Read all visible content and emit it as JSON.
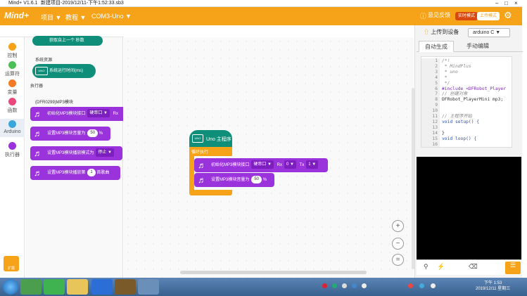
{
  "titlebar": {
    "app_version": "Mind+ V1.6.1",
    "file_title": "新建项目-2019/12/11-下午1:52:33.sb3",
    "minimize": "–",
    "maximize": "□",
    "close": "×"
  },
  "header": {
    "logo": "Mind+",
    "menu": {
      "project": "项目 ▼",
      "tutorial": "教程 ▼",
      "port": "COM3-Uno ▼"
    },
    "feedback": "意见反馈",
    "realtime_mode": "实时模式",
    "upload_mode": "上传模式",
    "settings_icon": "gear-icon"
  },
  "categories": {
    "module_tab": "模块",
    "items": [
      {
        "label": "控制",
        "color": "#f6a31a"
      },
      {
        "label": "运算符",
        "color": "#4cbf56"
      },
      {
        "label": "变量",
        "color": "#f47b25"
      },
      {
        "label": "函数",
        "color": "#e8487a"
      },
      {
        "label": "Arduino",
        "color": "#3aa6d9"
      },
      {
        "label": "执行器",
        "color": "#9b33dd"
      }
    ],
    "extension_label": "扩展"
  },
  "palette": {
    "partial_block": "获取自上一个  秒数",
    "system_resource_label": "系统资源",
    "system_runtime_block": "系统运行时间(ms)",
    "actuator_label": "执行器",
    "dfr_section_label": "(DFR0299)MP3模块",
    "blocks": {
      "init_text": "初始化MP3模块接口",
      "init_port": "硬串口 ▼",
      "init_rx": "Rx",
      "volume_text": "设置MP3模块音量为",
      "volume_value": "50",
      "volume_unit": "%",
      "play_text": "设置MP3模块播放模式为",
      "play_mode": "停止 ▼",
      "song_text": "设置MP3模块播放第",
      "song_value": "1",
      "song_unit": "首歌曲"
    }
  },
  "workspace": {
    "hat_icon_text": "UNO",
    "hat_label": "Uno 主程序",
    "loop_label": "循环执行",
    "init_block": {
      "text": "初始化MP3模块接口",
      "port": "硬串口 ▼",
      "rx_label": "Rx",
      "rx_value": "0 ▼",
      "tx_label": "Tx",
      "tx_value": "1 ▼"
    },
    "volume_block": {
      "text": "设置MP3模块音量为",
      "value": "50",
      "unit": "%"
    },
    "zoom_in": "+",
    "zoom_out": "−",
    "zoom_reset": "="
  },
  "right_panel": {
    "upload_button": "上传到设备",
    "board_select": "arduino C ▼",
    "tabs": {
      "auto": "自动生成",
      "manual": "手动编辑"
    },
    "code_lines": [
      {
        "no": "1",
        "text": "/*!",
        "cls": "cm"
      },
      {
        "no": "2",
        "text": " * MindPlus",
        "cls": "cm"
      },
      {
        "no": "3",
        "text": " * uno",
        "cls": "cm"
      },
      {
        "no": "4",
        "text": " *",
        "cls": "cm"
      },
      {
        "no": "5",
        "text": " */",
        "cls": "cm"
      },
      {
        "no": "6",
        "text": "#include <DFRobot_Player",
        "cls": "pp"
      },
      {
        "no": "7",
        "text": "// 创建对象",
        "cls": "cm"
      },
      {
        "no": "8",
        "text": "DFRobot_PlayerMini mp3;",
        "cls": ""
      },
      {
        "no": "9",
        "text": "",
        "cls": ""
      },
      {
        "no": "10",
        "text": "",
        "cls": ""
      },
      {
        "no": "11",
        "text": "// 主程序开始",
        "cls": "cm"
      },
      {
        "no": "12",
        "text": "void setup() {",
        "cls": "kw"
      },
      {
        "no": "13",
        "text": "",
        "cls": ""
      },
      {
        "no": "14",
        "text": "}",
        "cls": ""
      },
      {
        "no": "15",
        "text": "void loop() {",
        "cls": "kw"
      },
      {
        "no": "16",
        "text": "",
        "cls": ""
      }
    ]
  },
  "taskbar": {
    "time": "下午 1:53",
    "date": "2019/12/11 星期三"
  }
}
